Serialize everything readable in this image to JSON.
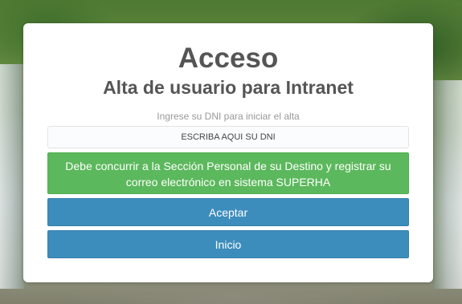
{
  "login": {
    "title": "Acceso",
    "subtitle": "Alta de usuario para Intranet",
    "hint": "Ingrese su DNI para iniciar el alta",
    "dni_placeholder": "ESCRIBA AQUI SU DNI",
    "dni_value": "",
    "notice": "Debe concurrir a la Sección Personal de su Destino y registrar su correo electrónico en sistema SUPERHA",
    "accept_label": "Aceptar",
    "home_label": "Inicio"
  },
  "colors": {
    "notice_bg": "#5cb85c",
    "button_bg": "#3c8dbc",
    "title_text": "#555555"
  }
}
